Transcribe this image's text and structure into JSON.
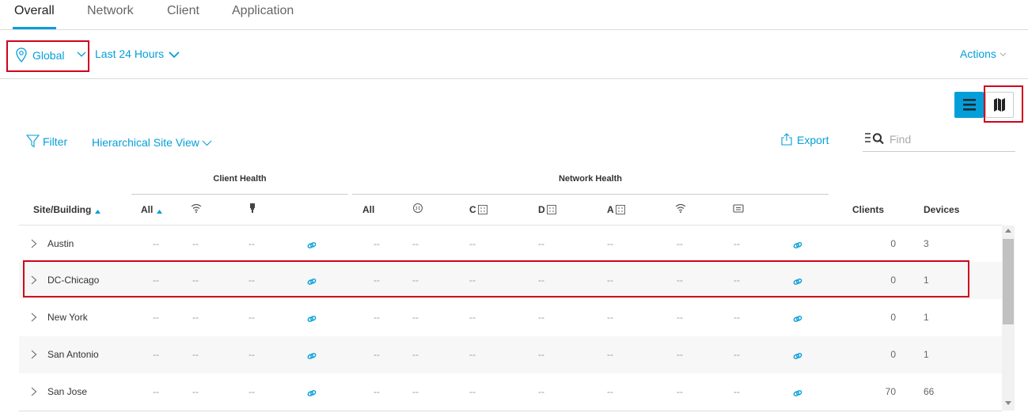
{
  "tabs": [
    {
      "label": "Overall",
      "active": true
    },
    {
      "label": "Network",
      "active": false
    },
    {
      "label": "Client",
      "active": false
    },
    {
      "label": "Application",
      "active": false
    }
  ],
  "location": {
    "label": "Global",
    "icon": "location-pin-icon"
  },
  "time_range": {
    "label": "Last 24 Hours"
  },
  "actions": {
    "label": "Actions"
  },
  "view_toggle": {
    "list_icon": "list-view-icon",
    "map_icon": "map-view-icon",
    "active": "list"
  },
  "filter": {
    "label": "Filter",
    "icon": "filter-icon"
  },
  "site_view": {
    "label": "Hierarchical Site View"
  },
  "export": {
    "label": "Export",
    "icon": "export-icon"
  },
  "find": {
    "placeholder": "Find",
    "icon": "search-icon"
  },
  "groups": {
    "client_health": "Client Health",
    "network_health": "Network Health"
  },
  "columns": {
    "site": "Site/Building",
    "client_all": "All",
    "client_wireless_icon": "wifi-icon",
    "client_wired_icon": "wired-icon",
    "net_all": "All",
    "net_router_icon": "router-icon",
    "net_core": "C",
    "net_distribution": "D",
    "net_access": "A",
    "net_wireless_icon": "wifi-icon",
    "net_wlc_icon": "wlc-icon",
    "clients": "Clients",
    "devices": "Devices"
  },
  "rows": [
    {
      "site": "Austin",
      "c_all": "--",
      "c_wifi": "--",
      "c_wired": "--",
      "n_all": "--",
      "n_router": "--",
      "n_core": "--",
      "n_dist": "--",
      "n_access": "--",
      "n_wifi": "--",
      "n_wlc": "--",
      "clients": "0",
      "devices": "3"
    },
    {
      "site": "DC-Chicago",
      "c_all": "--",
      "c_wifi": "--",
      "c_wired": "--",
      "n_all": "--",
      "n_router": "--",
      "n_core": "--",
      "n_dist": "--",
      "n_access": "--",
      "n_wifi": "--",
      "n_wlc": "--",
      "clients": "0",
      "devices": "1"
    },
    {
      "site": "New York",
      "c_all": "--",
      "c_wifi": "--",
      "c_wired": "--",
      "n_all": "--",
      "n_router": "--",
      "n_core": "--",
      "n_dist": "--",
      "n_access": "--",
      "n_wifi": "--",
      "n_wlc": "--",
      "clients": "0",
      "devices": "1"
    },
    {
      "site": "San Antonio",
      "c_all": "--",
      "c_wifi": "--",
      "c_wired": "--",
      "n_all": "--",
      "n_router": "--",
      "n_core": "--",
      "n_dist": "--",
      "n_access": "--",
      "n_wifi": "--",
      "n_wlc": "--",
      "clients": "0",
      "devices": "1"
    },
    {
      "site": "San Jose",
      "c_all": "--",
      "c_wifi": "--",
      "c_wired": "--",
      "n_all": "--",
      "n_router": "--",
      "n_core": "--",
      "n_dist": "--",
      "n_access": "--",
      "n_wifi": "--",
      "n_wlc": "--",
      "clients": "70",
      "devices": "66"
    }
  ],
  "colors": {
    "accent": "#049fd9",
    "highlight": "#d0021b"
  }
}
